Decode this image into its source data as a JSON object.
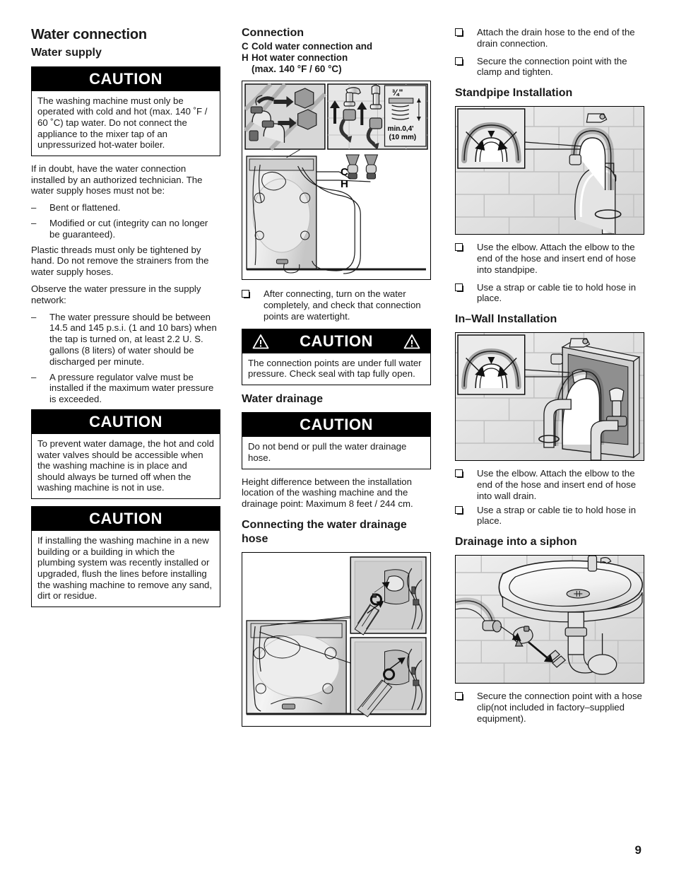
{
  "document": {
    "page_number": "9"
  },
  "left_column": {
    "title": "Water connection",
    "subtitle": "Water supply",
    "caution1": {
      "heading": "CAUTION",
      "text": "The washing machine must only be operated with cold and hot (max. 140 ˚F / 60 ˚C) tap water. Do not connect the appliance to the mixer tap of an unpressurized hot-water boiler."
    },
    "para1": "If in doubt, have the water connection installed by an authorized technician. The water supply hoses must not be:",
    "dash_list1": [
      "Bent or flattened.",
      "Modified or cut (integrity can no longer be guaranteed)."
    ],
    "para2": "Plastic threads must only be tightened by hand. Do not remove the strainers from the water supply hoses.",
    "para3": "Observe the water pressure in the supply network:",
    "dash_list2": [
      "The water pressure should be between 14.5 and 145 p.s.i. (1 and 10 bars) when the tap is turned on, at least 2.2 U. S. gallons (8 liters) of water should be discharged per minute.",
      "A pressure regulator valve must be installed if the maximum water pressure is exceeded."
    ],
    "caution2": {
      "heading": "CAUTION",
      "text": "To prevent water damage, the hot and cold water valves should be accessible when the washing machine is in place and should always be turned off when the washing machine is not in use."
    },
    "caution3": {
      "heading": "CAUTION",
      "text": "If installing the washing machine in a new building or a building in which the plumbing system was recently installed or upgraded, flush the lines before installing the washing machine to remove any sand, dirt or residue."
    }
  },
  "middle_column": {
    "heading": "Connection",
    "legend": [
      {
        "key": "C",
        "text": "Cold water connection and"
      },
      {
        "key": "H",
        "text": "Hot water connection"
      }
    ],
    "legend_note": "(max. 140 °F / 60 °C)",
    "figure_connection": {
      "name": "water-connection-diagram",
      "labels": {
        "cold": "C",
        "hot": "H",
        "thread_size": "3/4\"",
        "thread_min": "min.0,4'",
        "thread_min_metric": "(10 mm)"
      }
    },
    "bullet1": "After connecting, turn on the water completely, and check that connection points are watertight.",
    "caution_pressure": {
      "heading": "CAUTION",
      "text": "The connection points are under full water pressure. Check seal with tap fully open."
    },
    "heading2": "Water drainage",
    "caution_drainage": {
      "heading": "CAUTION",
      "text": "Do not bend or pull the water drainage hose."
    },
    "para_height": "Height difference between the installation location of the washing machine and the drainage point: Maximum 8 feet / 244 cm.",
    "heading3": "Connecting the water drainage hose",
    "figure_drainage": {
      "name": "drainage-hose-connection-diagram"
    }
  },
  "right_column": {
    "bullets_top": [
      "Attach the drain hose to the end of the drain connection.",
      "Secure the connection point with the clamp and tighten."
    ],
    "heading_standpipe": "Standpipe Installation",
    "figure_standpipe": {
      "name": "standpipe-installation-diagram"
    },
    "bullets_standpipe": [
      "Use the elbow. Attach the elbow to the end of the hose and insert end of hose into standpipe.",
      "Use a strap or cable tie to hold hose in place."
    ],
    "heading_inwall": "In–Wall Installation",
    "figure_inwall": {
      "name": "in-wall-installation-diagram"
    },
    "bullets_inwall": [
      "Use the elbow. Attach the elbow to the end of the hose and insert end of hose into wall drain.",
      "Use a strap or cable tie to hold hose in place."
    ],
    "heading_siphon": "Drainage into a siphon",
    "figure_siphon": {
      "name": "siphon-drainage-diagram"
    },
    "bullets_siphon": [
      "Secure the connection point with a hose clip(not included in factory–supplied equipment)."
    ]
  }
}
